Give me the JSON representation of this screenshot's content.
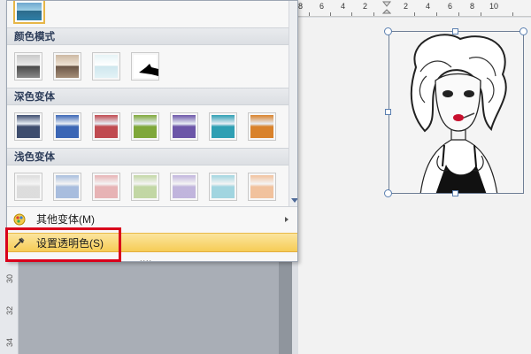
{
  "panel": {
    "sections": [
      {
        "title": "颜色模式"
      },
      {
        "title": "深色变体"
      },
      {
        "title": "浅色变体"
      }
    ],
    "menu": {
      "more_variants": "其他变体(M)",
      "set_transparent": "设置透明色(S)"
    },
    "grip": "....",
    "swatch_colors": {
      "dark": [
        "#3e4d6e",
        "#3b66b5",
        "#c04a50",
        "#7fa83a",
        "#6c56a8",
        "#2f9fb3",
        "#d9822b"
      ],
      "light": [
        "#d8d8d8",
        "#9ab3d9",
        "#e4a7a9",
        "#b9d196",
        "#b7a9d8",
        "#92cfdc",
        "#f0b88d"
      ]
    }
  },
  "ruler": {
    "top_numbers": [
      "8",
      "6",
      "4",
      "2",
      "2",
      "4",
      "6",
      "8",
      "10"
    ],
    "side_numbers": [
      "30",
      "32",
      "34"
    ]
  },
  "colors": {
    "highlight": "#f6cc56",
    "annotation": "#d9001b",
    "section_text": "#2d3d5a"
  }
}
